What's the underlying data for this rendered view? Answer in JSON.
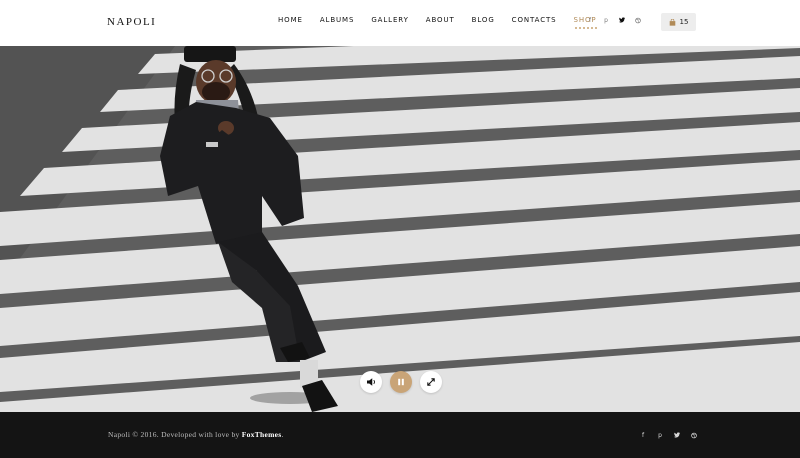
{
  "header": {
    "logo": "NAPOLI",
    "nav": [
      {
        "label": "HOME"
      },
      {
        "label": "ALBUMS"
      },
      {
        "label": "GALLERY"
      },
      {
        "label": "ABOUT"
      },
      {
        "label": "BLOG"
      },
      {
        "label": "CONTACTS"
      },
      {
        "label": "SHOP"
      }
    ],
    "active_nav": "SHOP",
    "social_icons": [
      "facebook-icon",
      "pinterest-icon",
      "twitter-icon",
      "dribbble-icon"
    ],
    "cart": {
      "count": "15",
      "icon": "shopping-bag-icon"
    }
  },
  "hero": {
    "image": "man in black clothing crossing a crosswalk",
    "controls": [
      "volume-icon",
      "pause-icon",
      "fullscreen-icon"
    ]
  },
  "footer": {
    "copyright_prefix": "Napoli © 2016. Developed with love by ",
    "copyright_brand": "FoxThemes",
    "copyright_suffix": ".",
    "social_icons": [
      "facebook-icon",
      "pinterest-icon",
      "twitter-icon",
      "dribbble-icon"
    ]
  },
  "colors": {
    "accent": "#c9a477",
    "footer_bg": "#141414",
    "cart_bg": "#ededed"
  }
}
